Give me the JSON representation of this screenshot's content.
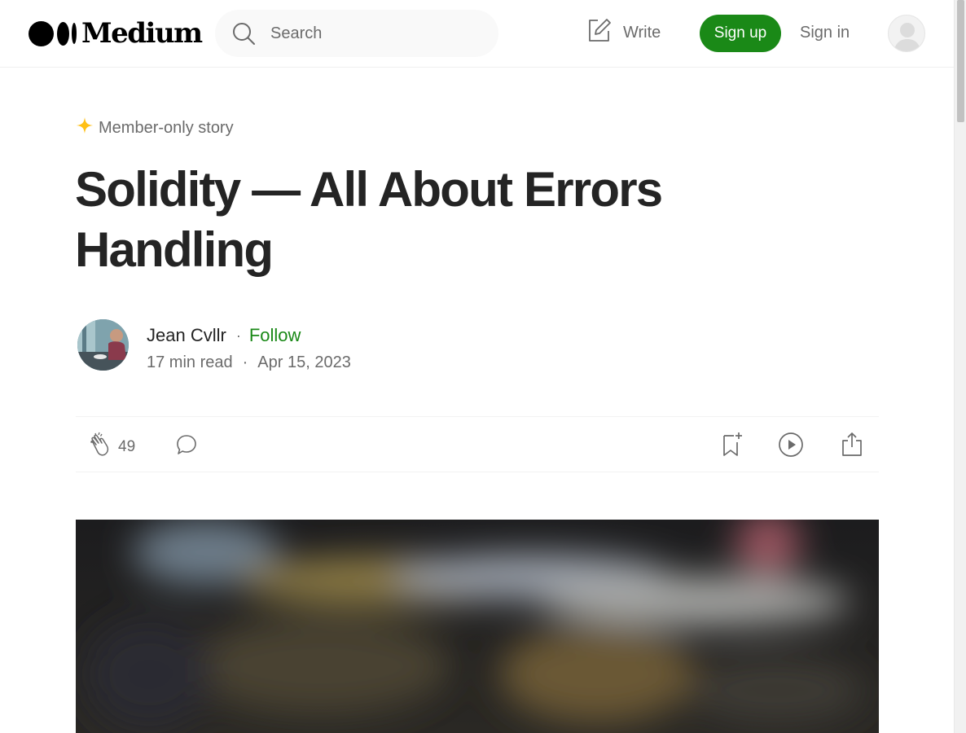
{
  "header": {
    "logo_text": "Medium",
    "search_placeholder": "Search",
    "write_label": "Write",
    "signup_label": "Sign up",
    "signin_label": "Sign in"
  },
  "article": {
    "member_badge": "Member-only story",
    "title": "Solidity — All About Errors Handling",
    "author": {
      "name": "Jean Cvllr",
      "separator": "·",
      "follow_label": "Follow"
    },
    "meta": {
      "read_time": "17 min read",
      "separator": "·",
      "date": "Apr 15, 2023"
    },
    "actions": {
      "clap_count": "49"
    }
  },
  "colors": {
    "accent_green": "#1a8917",
    "member_star": "#ffc017",
    "text_primary": "#242424",
    "text_secondary": "#6b6b6b"
  },
  "icons": [
    "search-icon",
    "write-icon",
    "user-avatar-icon",
    "star-icon",
    "clap-icon",
    "comment-icon",
    "bookmark-icon",
    "play-icon",
    "share-icon"
  ]
}
